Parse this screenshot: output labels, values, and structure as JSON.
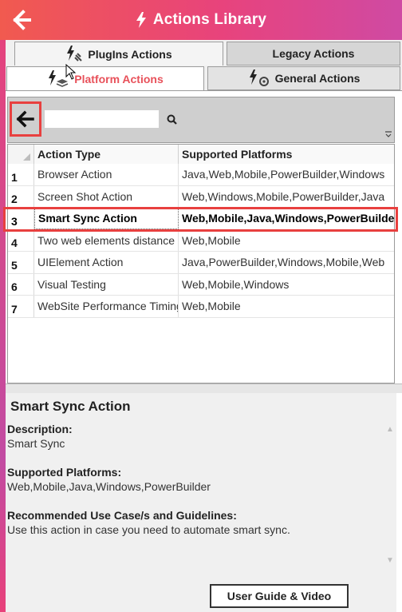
{
  "header": {
    "title": "Actions Library",
    "back_icon": "arrow-left-icon",
    "title_icon": "lightning-bolt-icon"
  },
  "tabs": {
    "plugins": {
      "label": "PlugIns Actions",
      "icon": "plug-bolt-icon"
    },
    "legacy": {
      "label": "Legacy Actions"
    },
    "platform": {
      "label": "Platform Actions",
      "icon": "bolt-layers-icon",
      "active": true
    },
    "general": {
      "label": "General Actions",
      "icon": "bolt-gear-icon"
    }
  },
  "search": {
    "value": "",
    "placeholder": "",
    "back_icon": "arrow-left-icon",
    "search_icon": "search-icon"
  },
  "grid": {
    "columns": [
      "Action Type",
      "Supported Platforms"
    ],
    "rows": [
      {
        "num": "1",
        "type": "Browser Action",
        "platforms": "Java,Web,Mobile,PowerBuilder,Windows"
      },
      {
        "num": "2",
        "type": "Screen Shot Action",
        "platforms": "Web,Windows,Mobile,PowerBuilder,Java"
      },
      {
        "num": "3",
        "type": "Smart Sync Action",
        "platforms": "Web,Mobile,Java,Windows,PowerBuilder"
      },
      {
        "num": "4",
        "type": "Two web elements distance",
        "platforms": "Web,Mobile"
      },
      {
        "num": "5",
        "type": "UIElement Action",
        "platforms": "Java,PowerBuilder,Windows,Mobile,Web"
      },
      {
        "num": "6",
        "type": "Visual Testing",
        "platforms": "Web,Mobile,Windows"
      },
      {
        "num": "7",
        "type": "WebSite Performance Timing",
        "platforms": "Web,Mobile"
      }
    ],
    "selected_index": 2
  },
  "details": {
    "title": "Smart Sync Action",
    "description_label": "Description:",
    "description": "Smart Sync",
    "platforms_label": "Supported Platforms:",
    "platforms": "Web,Mobile,Java,Windows,PowerBuilder",
    "usecase_label": "Recommended Use Case/s and Guidelines:",
    "usecase": "Use this action in case you need to automate smart sync."
  },
  "guide_button": {
    "label": "User Guide & Video"
  },
  "colors": {
    "header_start": "#f15a4f",
    "header_end": "#cf4aa3",
    "highlight": "#e8403f",
    "active_tab_text": "#e8515a"
  }
}
